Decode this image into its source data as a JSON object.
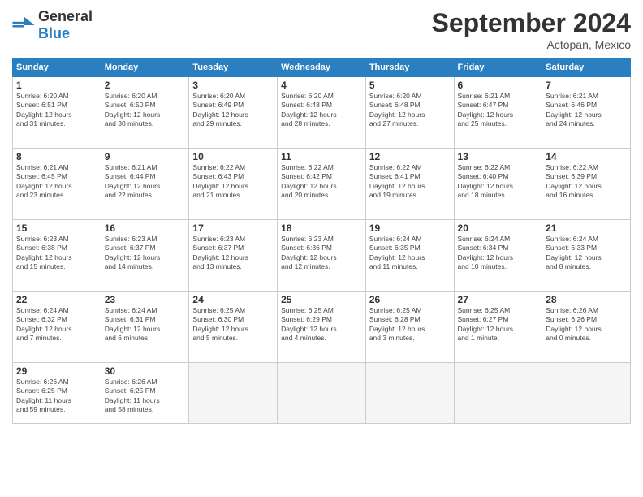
{
  "header": {
    "logo": {
      "general": "General",
      "blue": "Blue"
    },
    "title": "September 2024",
    "location": "Actopan, Mexico"
  },
  "columns": [
    "Sunday",
    "Monday",
    "Tuesday",
    "Wednesday",
    "Thursday",
    "Friday",
    "Saturday"
  ],
  "weeks": [
    [
      {
        "day": "1",
        "info": "Sunrise: 6:20 AM\nSunset: 6:51 PM\nDaylight: 12 hours\nand 31 minutes."
      },
      {
        "day": "2",
        "info": "Sunrise: 6:20 AM\nSunset: 6:50 PM\nDaylight: 12 hours\nand 30 minutes."
      },
      {
        "day": "3",
        "info": "Sunrise: 6:20 AM\nSunset: 6:49 PM\nDaylight: 12 hours\nand 29 minutes."
      },
      {
        "day": "4",
        "info": "Sunrise: 6:20 AM\nSunset: 6:48 PM\nDaylight: 12 hours\nand 28 minutes."
      },
      {
        "day": "5",
        "info": "Sunrise: 6:20 AM\nSunset: 6:48 PM\nDaylight: 12 hours\nand 27 minutes."
      },
      {
        "day": "6",
        "info": "Sunrise: 6:21 AM\nSunset: 6:47 PM\nDaylight: 12 hours\nand 25 minutes."
      },
      {
        "day": "7",
        "info": "Sunrise: 6:21 AM\nSunset: 6:46 PM\nDaylight: 12 hours\nand 24 minutes."
      }
    ],
    [
      {
        "day": "8",
        "info": "Sunrise: 6:21 AM\nSunset: 6:45 PM\nDaylight: 12 hours\nand 23 minutes."
      },
      {
        "day": "9",
        "info": "Sunrise: 6:21 AM\nSunset: 6:44 PM\nDaylight: 12 hours\nand 22 minutes."
      },
      {
        "day": "10",
        "info": "Sunrise: 6:22 AM\nSunset: 6:43 PM\nDaylight: 12 hours\nand 21 minutes."
      },
      {
        "day": "11",
        "info": "Sunrise: 6:22 AM\nSunset: 6:42 PM\nDaylight: 12 hours\nand 20 minutes."
      },
      {
        "day": "12",
        "info": "Sunrise: 6:22 AM\nSunset: 6:41 PM\nDaylight: 12 hours\nand 19 minutes."
      },
      {
        "day": "13",
        "info": "Sunrise: 6:22 AM\nSunset: 6:40 PM\nDaylight: 12 hours\nand 18 minutes."
      },
      {
        "day": "14",
        "info": "Sunrise: 6:22 AM\nSunset: 6:39 PM\nDaylight: 12 hours\nand 16 minutes."
      }
    ],
    [
      {
        "day": "15",
        "info": "Sunrise: 6:23 AM\nSunset: 6:38 PM\nDaylight: 12 hours\nand 15 minutes."
      },
      {
        "day": "16",
        "info": "Sunrise: 6:23 AM\nSunset: 6:37 PM\nDaylight: 12 hours\nand 14 minutes."
      },
      {
        "day": "17",
        "info": "Sunrise: 6:23 AM\nSunset: 6:37 PM\nDaylight: 12 hours\nand 13 minutes."
      },
      {
        "day": "18",
        "info": "Sunrise: 6:23 AM\nSunset: 6:36 PM\nDaylight: 12 hours\nand 12 minutes."
      },
      {
        "day": "19",
        "info": "Sunrise: 6:24 AM\nSunset: 6:35 PM\nDaylight: 12 hours\nand 11 minutes."
      },
      {
        "day": "20",
        "info": "Sunrise: 6:24 AM\nSunset: 6:34 PM\nDaylight: 12 hours\nand 10 minutes."
      },
      {
        "day": "21",
        "info": "Sunrise: 6:24 AM\nSunset: 6:33 PM\nDaylight: 12 hours\nand 8 minutes."
      }
    ],
    [
      {
        "day": "22",
        "info": "Sunrise: 6:24 AM\nSunset: 6:32 PM\nDaylight: 12 hours\nand 7 minutes."
      },
      {
        "day": "23",
        "info": "Sunrise: 6:24 AM\nSunset: 6:31 PM\nDaylight: 12 hours\nand 6 minutes."
      },
      {
        "day": "24",
        "info": "Sunrise: 6:25 AM\nSunset: 6:30 PM\nDaylight: 12 hours\nand 5 minutes."
      },
      {
        "day": "25",
        "info": "Sunrise: 6:25 AM\nSunset: 6:29 PM\nDaylight: 12 hours\nand 4 minutes."
      },
      {
        "day": "26",
        "info": "Sunrise: 6:25 AM\nSunset: 6:28 PM\nDaylight: 12 hours\nand 3 minutes."
      },
      {
        "day": "27",
        "info": "Sunrise: 6:25 AM\nSunset: 6:27 PM\nDaylight: 12 hours\nand 1 minute."
      },
      {
        "day": "28",
        "info": "Sunrise: 6:26 AM\nSunset: 6:26 PM\nDaylight: 12 hours\nand 0 minutes."
      }
    ],
    [
      {
        "day": "29",
        "info": "Sunrise: 6:26 AM\nSunset: 6:25 PM\nDaylight: 11 hours\nand 59 minutes."
      },
      {
        "day": "30",
        "info": "Sunrise: 6:26 AM\nSunset: 6:25 PM\nDaylight: 11 hours\nand 58 minutes."
      },
      {
        "day": "",
        "info": ""
      },
      {
        "day": "",
        "info": ""
      },
      {
        "day": "",
        "info": ""
      },
      {
        "day": "",
        "info": ""
      },
      {
        "day": "",
        "info": ""
      }
    ]
  ]
}
